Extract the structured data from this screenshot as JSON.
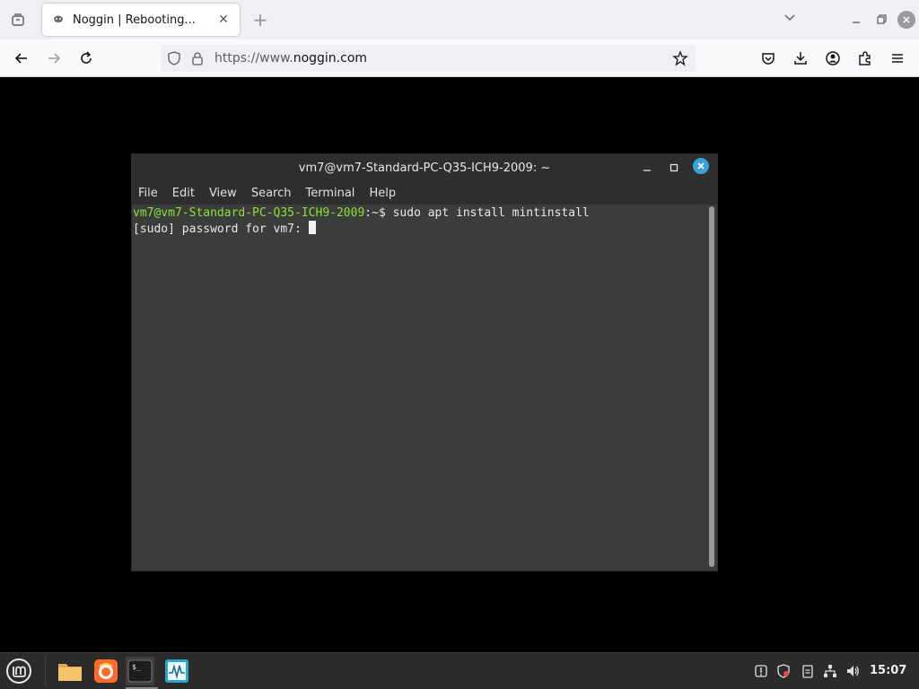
{
  "browser": {
    "tab": {
      "title": "Noggin | Rebooting..."
    },
    "url": {
      "scheme": "https://www.",
      "host": "noggin.com"
    }
  },
  "terminal": {
    "title": "vm7@vm7-Standard-PC-Q35-ICH9-2009: ~",
    "menu": [
      "File",
      "Edit",
      "View",
      "Search",
      "Terminal",
      "Help"
    ],
    "lines": [
      {
        "user_host": "vm7@vm7-Standard-PC-Q35-ICH9-2009",
        "path": ":~",
        "command": "$ sudo apt install mintinstall"
      },
      {
        "text": "[sudo] password for vm7: "
      }
    ],
    "colors": {
      "prompt": "#8ae234",
      "background": "#3c3c3c"
    }
  },
  "taskbar": {
    "clock": "15:07",
    "apps": [
      "files-icon",
      "firefox-icon",
      "terminal-icon",
      "system-monitor-icon"
    ]
  }
}
